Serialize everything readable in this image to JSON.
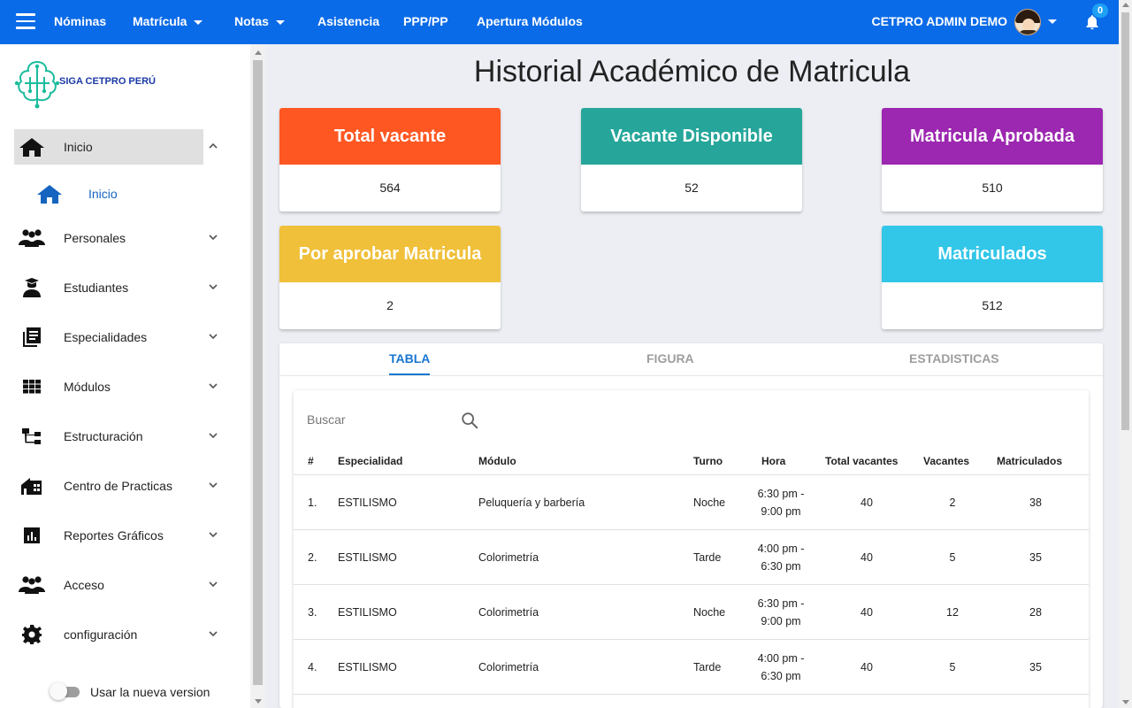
{
  "topbar": {
    "nav": [
      {
        "label": "Nóminas",
        "dropdown": false
      },
      {
        "label": "Matrícula",
        "dropdown": true
      },
      {
        "label": "Notas",
        "dropdown": true
      },
      {
        "label": "Asistencia",
        "dropdown": false
      },
      {
        "label": "PPP/PP",
        "dropdown": false
      },
      {
        "label": "Apertura Módulos",
        "dropdown": false
      }
    ],
    "user_name": "CETPRO ADMIN DEMO",
    "notification_count": "0",
    "bg_color": "#0a6be8"
  },
  "sidebar": {
    "logo_text": "SIGA CETPRO PERÚ",
    "items": [
      {
        "label": "Inicio",
        "icon": "home-icon",
        "expanded": true
      },
      {
        "label": "Personales",
        "icon": "people-icon",
        "expanded": false
      },
      {
        "label": "Estudiantes",
        "icon": "student-icon",
        "expanded": false
      },
      {
        "label": "Especialidades",
        "icon": "library-icon",
        "expanded": false
      },
      {
        "label": "Módulos",
        "icon": "grid-icon",
        "expanded": false
      },
      {
        "label": "Estructuración",
        "icon": "tree-icon",
        "expanded": false
      },
      {
        "label": "Centro de Practicas",
        "icon": "building-icon",
        "expanded": false
      },
      {
        "label": "Reportes Gráficos",
        "icon": "report-icon",
        "expanded": false
      },
      {
        "label": "Acceso",
        "icon": "people-icon",
        "expanded": false
      },
      {
        "label": "configuración",
        "icon": "gear-icon",
        "expanded": false
      }
    ],
    "subitem": {
      "label": "Inicio",
      "icon": "home-icon"
    },
    "toggle_label": "Usar la nueva version",
    "toggle_on": false
  },
  "main": {
    "title": "Historial Académico de Matricula",
    "cards": [
      {
        "title": "Total vacante",
        "value": "564",
        "color": "#ff5722"
      },
      {
        "title": "Vacante Disponible",
        "value": "52",
        "color": "#26a69a"
      },
      {
        "title": "Matricula Aprobada",
        "value": "510",
        "color": "#9c27b0"
      },
      {
        "title": "Por aprobar Matricula",
        "value": "2",
        "color": "#f0c03a"
      },
      {
        "title": "Matriculados",
        "value": "512",
        "color": "#32c6e8"
      }
    ],
    "tabs": [
      {
        "label": "TABLA",
        "active": true
      },
      {
        "label": "FIGURA",
        "active": false
      },
      {
        "label": "ESTADISTICAS",
        "active": false
      }
    ],
    "search": {
      "placeholder": "Buscar",
      "value": ""
    },
    "table": {
      "headers": [
        "#",
        "Especialidad",
        "Módulo",
        "Turno",
        "Hora",
        "Total vacantes",
        "Vacantes",
        "Matriculados"
      ],
      "rows": [
        {
          "num": "1.",
          "especialidad": "ESTILISMO",
          "modulo": "Peluquería y barbería",
          "turno": "Noche",
          "hora_1": "6:30 pm -",
          "hora_2": "9:00 pm",
          "total": "40",
          "vacantes": "2",
          "matriculados": "38"
        },
        {
          "num": "2.",
          "especialidad": "ESTILISMO",
          "modulo": "Colorimetría",
          "turno": "Tarde",
          "hora_1": "4:00 pm -",
          "hora_2": "6:30 pm",
          "total": "40",
          "vacantes": "5",
          "matriculados": "35"
        },
        {
          "num": "3.",
          "especialidad": "ESTILISMO",
          "modulo": "Colorimetría",
          "turno": "Noche",
          "hora_1": "6:30 pm -",
          "hora_2": "9:00 pm",
          "total": "40",
          "vacantes": "12",
          "matriculados": "28"
        },
        {
          "num": "4.",
          "especialidad": "ESTILISMO",
          "modulo": "Colorimetría",
          "turno": "Tarde",
          "hora_1": "4:00 pm -",
          "hora_2": "6:30 pm",
          "total": "40",
          "vacantes": "5",
          "matriculados": "35"
        }
      ]
    }
  }
}
